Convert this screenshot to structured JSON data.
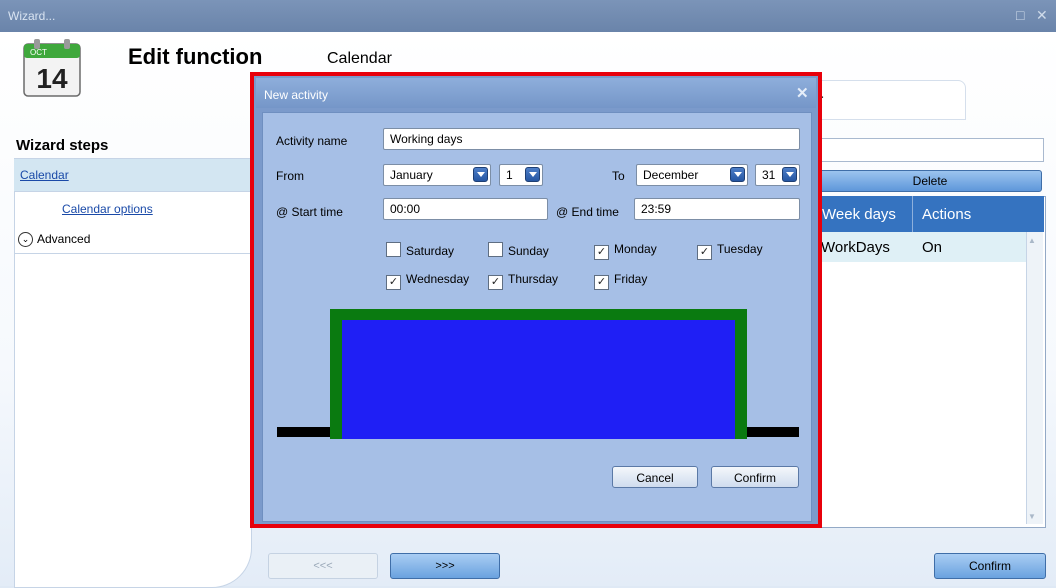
{
  "window": {
    "title": "Wizard...",
    "controls": {
      "restore": "□",
      "close": "✕"
    }
  },
  "header": {
    "icon": {
      "month": "OCT",
      "day": "14"
    },
    "title": "Edit function",
    "subtitle": "Calendar"
  },
  "sidebar": {
    "title": "Wizard steps",
    "items": [
      {
        "label": "Calendar"
      },
      {
        "label": "Calendar options"
      },
      {
        "label": "Advanced",
        "icon": "chevron-down-circle-icon"
      }
    ]
  },
  "background": {
    "tab_fragment": "r",
    "delete_label": "Delete",
    "grid": {
      "headers": [
        "Week days",
        "Actions"
      ],
      "rows": [
        {
          "week_days": "WorkDays",
          "action": "On"
        }
      ]
    },
    "nav": {
      "prev": "<<<",
      "next": ">>>",
      "confirm": "Confirm"
    }
  },
  "dialog": {
    "title": "New activity",
    "close": "✕",
    "activity_name_label": "Activity name",
    "activity_name_value": "Working days",
    "from_label": "From",
    "from_month": "January",
    "from_day": "1",
    "to_label": "To",
    "to_month": "December",
    "to_day": "31",
    "start_time_label": "@ Start time",
    "start_time_value": "00:00",
    "end_time_label": "@ End time",
    "end_time_value": "23:59",
    "days": [
      {
        "label": "Saturday",
        "checked": false
      },
      {
        "label": "Sunday",
        "checked": false
      },
      {
        "label": "Monday",
        "checked": true
      },
      {
        "label": "Tuesday",
        "checked": true
      },
      {
        "label": "Wednesday",
        "checked": true
      },
      {
        "label": "Thursday",
        "checked": true
      },
      {
        "label": "Friday",
        "checked": true
      }
    ],
    "cancel_label": "Cancel",
    "confirm_label": "Confirm",
    "highlight_color": "#e8000b",
    "graph_colors": {
      "fill": "#1f1ff5",
      "edge": "#0a7a10",
      "baseline": "#000000"
    }
  }
}
